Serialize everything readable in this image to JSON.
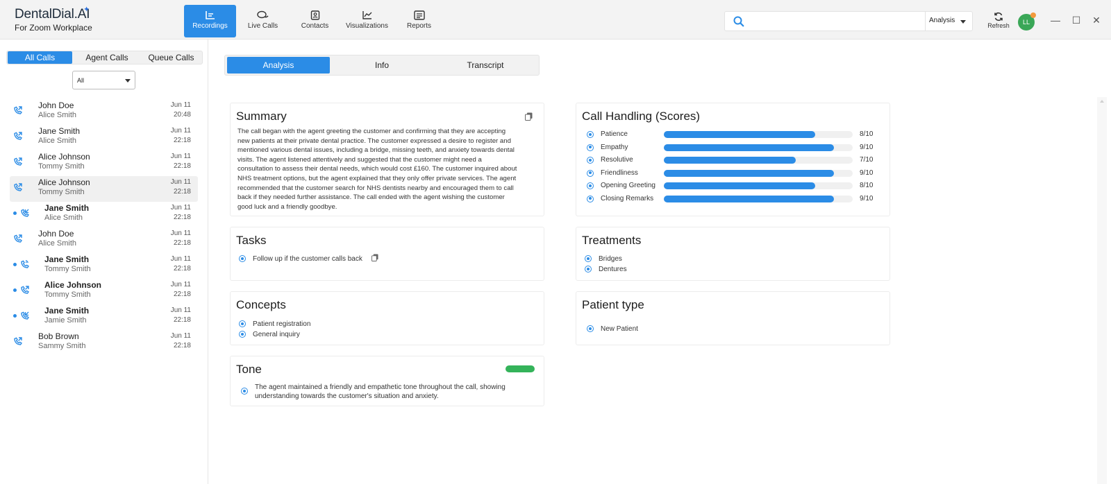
{
  "brand": {
    "name": "DentalDial.AI",
    "subtitle": "For Zoom Workplace"
  },
  "nav": [
    {
      "label": "Recordings",
      "icon": "recordings-icon",
      "active": true
    },
    {
      "label": "Live Calls",
      "icon": "chat-bubbles-icon"
    },
    {
      "label": "Contacts",
      "icon": "contacts-icon"
    },
    {
      "label": "Visualizations",
      "icon": "chart-icon"
    },
    {
      "label": "Reports",
      "icon": "reports-icon"
    }
  ],
  "search": {
    "placeholder": "",
    "scope": "Analysis"
  },
  "refresh_label": "Refresh",
  "avatar_initials": "LL",
  "window_controls": {
    "minimize": "—",
    "maximize": "☐",
    "close": "✕"
  },
  "sidebar": {
    "segments": [
      "All Calls",
      "Agent Calls",
      "Queue Calls"
    ],
    "filter": "All",
    "calls": [
      {
        "name": "John Doe",
        "agent": "Alice Smith",
        "date": "Jun 11",
        "time": "20:48",
        "icon": "outgoing-call-icon",
        "unread": false
      },
      {
        "name": "Jane Smith",
        "agent": "Alice Smith",
        "date": "Jun 11",
        "time": "22:18",
        "icon": "outgoing-call-icon",
        "unread": false
      },
      {
        "name": "Alice Johnson",
        "agent": "Tommy Smith",
        "date": "Jun 11",
        "time": "22:18",
        "icon": "outgoing-call-icon",
        "unread": false
      },
      {
        "name": "Alice Johnson",
        "agent": "Tommy Smith",
        "date": "Jun 11",
        "time": "22:18",
        "icon": "outgoing-call-icon",
        "unread": false,
        "selected": true
      },
      {
        "name": "Jane Smith",
        "agent": "Alice Smith",
        "date": "Jun 11",
        "time": "22:18",
        "icon": "incoming-call-icon",
        "unread": true
      },
      {
        "name": "John Doe",
        "agent": "Alice Smith",
        "date": "Jun 11",
        "time": "22:18",
        "icon": "outgoing-call-icon",
        "unread": false
      },
      {
        "name": "Jane Smith",
        "agent": "Tommy Smith",
        "date": "Jun 11",
        "time": "22:18",
        "icon": "ringing-call-icon",
        "unread": true
      },
      {
        "name": "Alice Johnson",
        "agent": "Tommy Smith",
        "date": "Jun 11",
        "time": "22:18",
        "icon": "outgoing-call-icon",
        "unread": true
      },
      {
        "name": "Jane Smith",
        "agent": "Jamie Smith",
        "date": "Jun 11",
        "time": "22:18",
        "icon": "incoming-call-icon",
        "unread": true
      },
      {
        "name": "Bob Brown",
        "agent": "Sammy Smith",
        "date": "Jun 11",
        "time": "22:18",
        "icon": "outgoing-call-icon",
        "unread": false
      }
    ]
  },
  "tabs": [
    "Analysis",
    "Info",
    "Transcript"
  ],
  "summary": {
    "title": "Summary",
    "text": "The call began with the agent greeting the customer and confirming that they are accepting new patients at their private dental practice. The customer expressed a desire to register and mentioned various dental issues, including a bridge, missing teeth, and anxiety towards dental visits. The agent listened attentively and suggested that the customer might need a consultation to assess their dental needs, which would cost £160. The customer inquired about NHS treatment options, but the agent explained that they only offer private services. The agent recommended that the customer search for NHS dentists nearby and encouraged them to call back if they needed further assistance. The call ended with the agent wishing the customer good luck and a friendly goodbye."
  },
  "call_handling": {
    "title": "Call Handling (Scores)",
    "scores": [
      {
        "label": "Patience",
        "value": 8,
        "max": 10,
        "display": "8/10"
      },
      {
        "label": "Empathy",
        "value": 9,
        "max": 10,
        "display": "9/10"
      },
      {
        "label": "Resolutive",
        "value": 7,
        "max": 10,
        "display": "7/10"
      },
      {
        "label": "Friendliness",
        "value": 9,
        "max": 10,
        "display": "9/10"
      },
      {
        "label": "Opening Greeting",
        "value": 8,
        "max": 10,
        "display": "8/10"
      },
      {
        "label": "Closing Remarks",
        "value": 9,
        "max": 10,
        "display": "9/10"
      }
    ]
  },
  "tasks": {
    "title": "Tasks",
    "items": [
      "Follow up if the customer calls back"
    ]
  },
  "treatments": {
    "title": "Treatments",
    "items": [
      "Bridges",
      "Dentures"
    ]
  },
  "concepts": {
    "title": "Concepts",
    "items": [
      "Patient registration",
      "General inquiry"
    ]
  },
  "patient_type": {
    "title": "Patient type",
    "items": [
      "New Patient"
    ]
  },
  "tone": {
    "title": "Tone",
    "indicator_color": "#34b35a",
    "text": "The agent maintained a friendly and empathetic tone throughout the call, showing understanding towards the customer's situation and anxiety."
  },
  "colors": {
    "accent": "#2b8ce6",
    "unread_dot": "#2b8ce6",
    "avatar": "#3aa757",
    "avatar_status": "#f39a3d"
  }
}
